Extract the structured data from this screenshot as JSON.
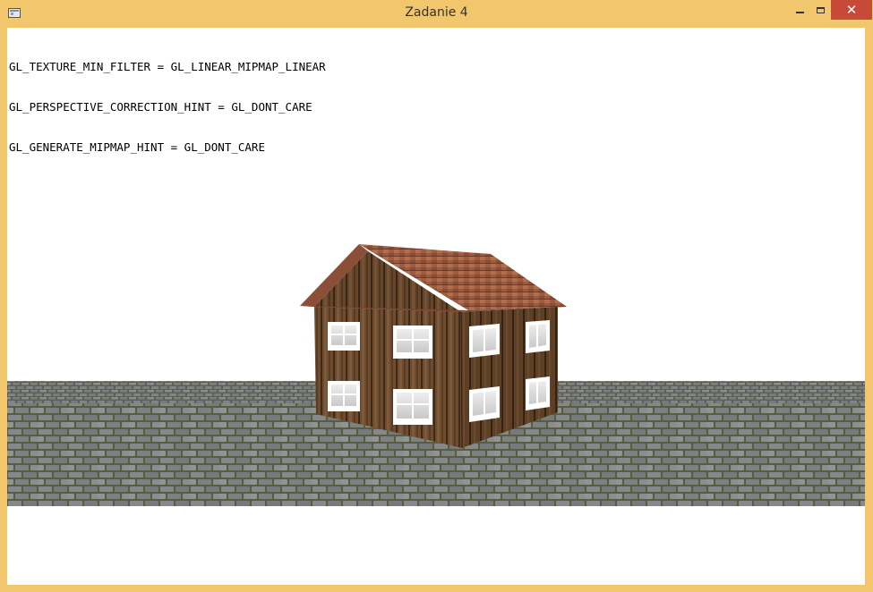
{
  "window": {
    "title": "Zadanie 4",
    "controls": {
      "minimize_icon": "minimize-icon",
      "maximize_icon": "maximize-icon",
      "close_label": "✕"
    }
  },
  "overlay": {
    "lines": [
      "GL_TEXTURE_MIN_FILTER = GL_LINEAR_MIPMAP_LINEAR",
      "GL_PERSPECTIVE_CORRECTION_HINT = GL_DONT_CARE",
      "GL_GENERATE_MIPMAP_HINT = GL_DONT_CARE"
    ]
  },
  "scene": {
    "colors": {
      "background": "#ffffff",
      "ground_stone": "#8a8c8e",
      "ground_grout": "#5e6344",
      "wood_wall": "#6b4a2e",
      "roof": "#9b5a3c",
      "window_frame": "#ffffff",
      "window_glass": "#d9d9d9"
    }
  }
}
